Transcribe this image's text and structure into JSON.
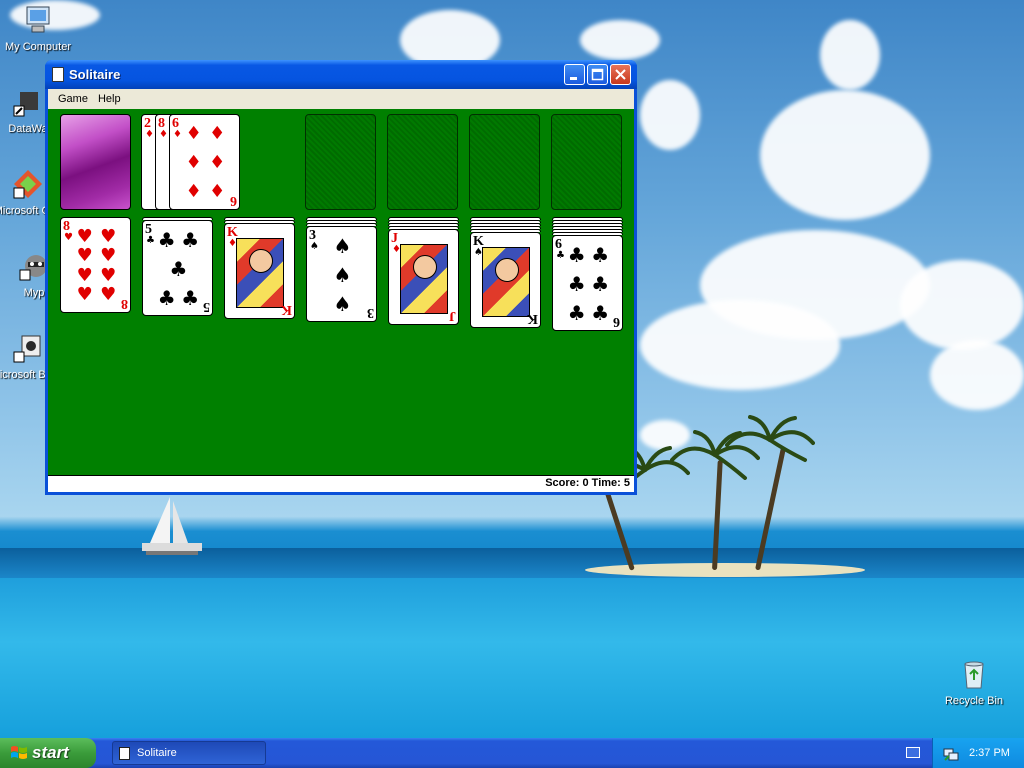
{
  "desktop": {
    "icons": [
      {
        "label": "My Computer"
      },
      {
        "label": "DataWa"
      },
      {
        "label": "Microsoft C++"
      },
      {
        "label": "Myp"
      },
      {
        "label": "Microsoft Basic"
      },
      {
        "label": "Recycle Bin"
      }
    ]
  },
  "window": {
    "title": "Solitaire",
    "menu": [
      "Game",
      "Help"
    ],
    "status": "Score: 0 Time: 5"
  },
  "game": {
    "waste": [
      {
        "rank": "2",
        "suit": "♦",
        "color": "red"
      },
      {
        "rank": "8",
        "suit": "♦",
        "color": "red"
      },
      {
        "rank": "6",
        "suit": "♦",
        "color": "red"
      }
    ],
    "tableau": [
      {
        "rank": "8",
        "suit": "♥",
        "color": "red",
        "hidden": 0
      },
      {
        "rank": "5",
        "suit": "♣",
        "color": "black",
        "hidden": 1
      },
      {
        "rank": "K",
        "suit": "♦",
        "color": "red",
        "hidden": 2
      },
      {
        "rank": "3",
        "suit": "♠",
        "color": "black",
        "hidden": 3
      },
      {
        "rank": "J",
        "suit": "♦",
        "color": "red",
        "hidden": 4
      },
      {
        "rank": "K",
        "suit": "♠",
        "color": "black",
        "hidden": 5
      },
      {
        "rank": "6",
        "suit": "♣",
        "color": "black",
        "hidden": 6
      }
    ]
  },
  "taskbar": {
    "start_label": "start",
    "task_label": "Solitaire",
    "clock": "2:37 PM"
  }
}
